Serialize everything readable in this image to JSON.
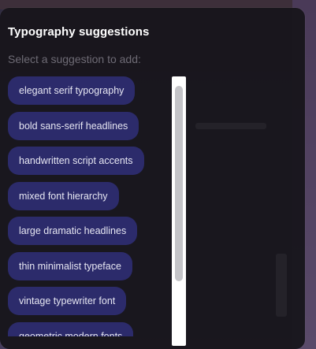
{
  "panel": {
    "title": "Typography suggestions",
    "subtitle": "Select a suggestion to add:"
  },
  "suggestions": [
    {
      "label": "elegant serif typography"
    },
    {
      "label": "bold sans-serif headlines"
    },
    {
      "label": "handwritten script accents"
    },
    {
      "label": "mixed font hierarchy"
    },
    {
      "label": "large dramatic headlines"
    },
    {
      "label": "thin minimalist typeface"
    },
    {
      "label": "vintage typewriter font"
    },
    {
      "label": "geometric modern fonts"
    }
  ],
  "colors": {
    "chip_bg": "#2c2b6b",
    "chip_text": "#e6e6f2",
    "panel_bg": "#18161c",
    "title": "#ffffff",
    "subtitle": "#6e6b75"
  }
}
